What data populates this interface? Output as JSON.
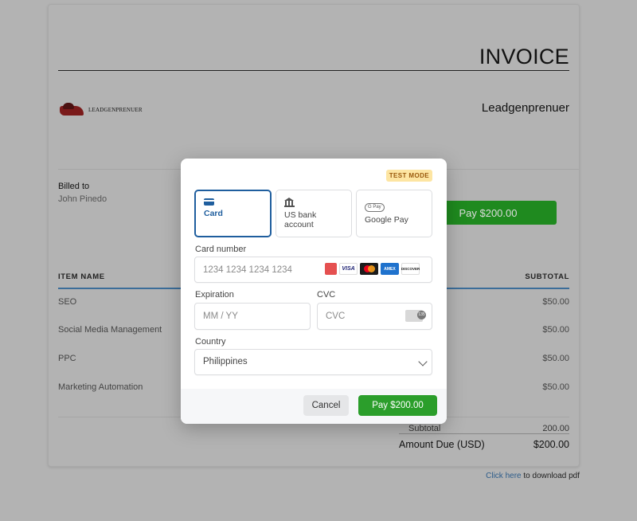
{
  "invoice": {
    "title": "INVOICE",
    "logo_text": "LEADGENPRENUER",
    "company_name": "Leadgenprenuer",
    "billed_to_label": "Billed to",
    "billed_to_name": "John Pinedo",
    "pay_button": "Pay $200.00",
    "table": {
      "headers": {
        "item": "ITEM NAME",
        "subtotal": "SUBTOTAL"
      },
      "rows": [
        {
          "name": "SEO",
          "subtotal": "$50.00"
        },
        {
          "name": "Social Media Management",
          "subtotal": "$50.00"
        },
        {
          "name": "PPC",
          "subtotal": "$50.00"
        },
        {
          "name": "Marketing Automation",
          "subtotal": "$50.00"
        }
      ]
    },
    "subtotal_label": "Subtotal",
    "subtotal_value": "200.00",
    "amount_due_label": "Amount Due (USD)",
    "amount_due_value": "$200.00",
    "download_link": "Click here",
    "download_text": " to download pdf"
  },
  "modal": {
    "badge": "TEST MODE",
    "methods": [
      {
        "label": "Card",
        "icon": "credit-card-icon",
        "selected": true
      },
      {
        "label": "US bank account",
        "icon": "bank-icon",
        "selected": false
      },
      {
        "label": "Google Pay",
        "icon": "google-pay-icon",
        "selected": false
      }
    ],
    "gpay_icon_text": "G Pay",
    "card_number_label": "Card number",
    "card_number_placeholder": "1234 1234 1234 1234",
    "brands": {
      "visa": "VISA",
      "amex": "AMEX",
      "discover": "DISCOVER"
    },
    "expiration_label": "Expiration",
    "expiration_placeholder": "MM / YY",
    "cvc_label": "CVC",
    "cvc_placeholder": "CVC",
    "cvc_icon_text": "135",
    "country_label": "Country",
    "country_value": "Philippines",
    "cancel_button": "Cancel",
    "pay_button": "Pay $200.00"
  },
  "colors": {
    "overlay": "#b3b3b3",
    "accent_blue": "#1f5e9e",
    "pay_green": "#2b9e2b",
    "badge_bg": "#fde5a2"
  }
}
